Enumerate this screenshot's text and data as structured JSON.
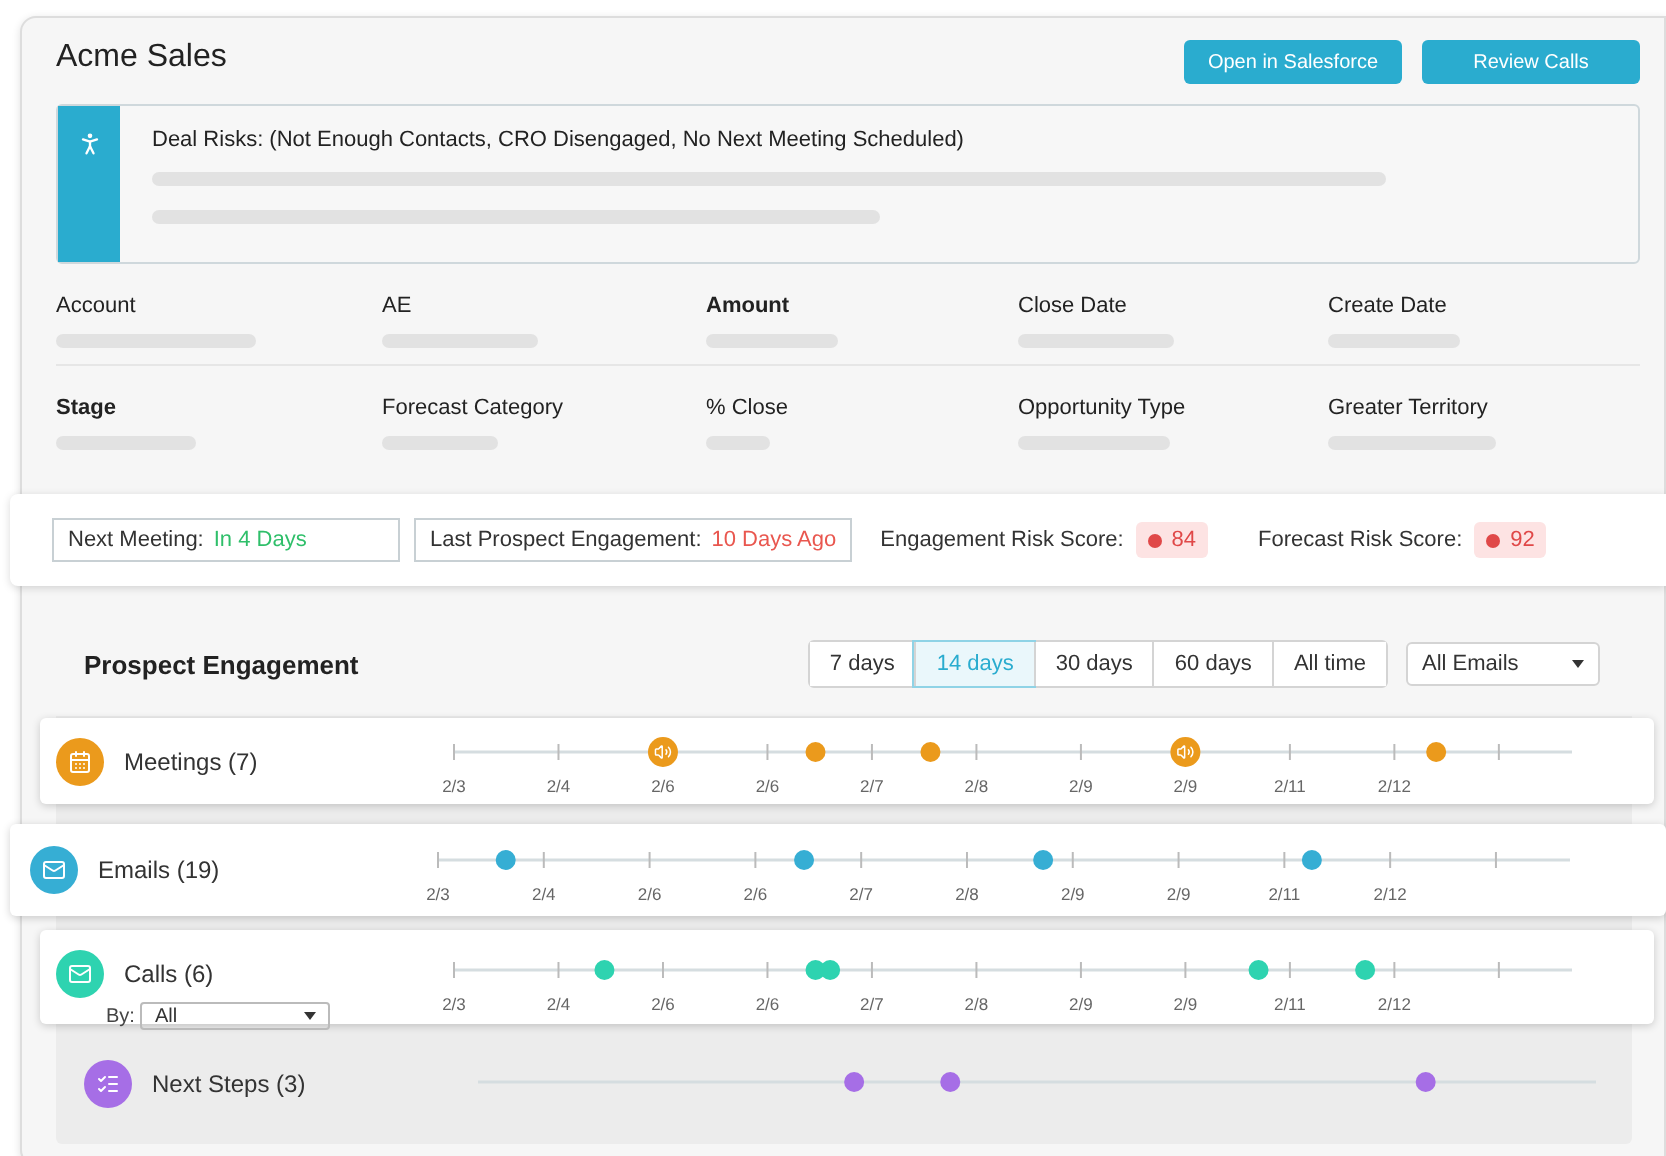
{
  "header": {
    "title": "Acme Sales",
    "buttons": [
      "Open in Salesforce",
      "Review Calls"
    ]
  },
  "alert": {
    "text": "Deal Risks: (Not Enough Contacts, CRO Disengaged, No Next Meeting Scheduled)"
  },
  "fields": [
    {
      "label": "Account",
      "emphasized": false
    },
    {
      "label": "AE",
      "emphasized": false
    },
    {
      "label": "Amount",
      "emphasized": true
    },
    {
      "label": "Close Date",
      "emphasized": false
    },
    {
      "label": "Create Date",
      "emphasized": false
    },
    {
      "label": "Stage",
      "emphasized": true
    },
    {
      "label": "Forecast Category",
      "emphasized": false
    },
    {
      "label": "% Close",
      "emphasized": false
    },
    {
      "label": "Opportunity Type",
      "emphasized": false
    },
    {
      "label": "Greater Territory",
      "emphasized": false
    }
  ],
  "metrics": [
    {
      "kind": "boxed",
      "label": "Next Meeting:",
      "value": "In 4 Days",
      "color": "#2fbf6a"
    },
    {
      "kind": "boxed",
      "label": "Last Prospect Engagement:",
      "value": "10 Days Ago",
      "color": "#e9574f"
    },
    {
      "kind": "score",
      "label": "Engagement Risk Score:",
      "value": "84",
      "color": "#e04848"
    },
    {
      "kind": "score",
      "label": "Forecast Risk Score:",
      "value": "92",
      "color": "#e04848"
    }
  ],
  "engagement": {
    "title": "Prospect Engagement",
    "ranges": [
      {
        "label": "7 days",
        "selected": false
      },
      {
        "label": "14 days",
        "selected": true
      },
      {
        "label": "30 days",
        "selected": false
      },
      {
        "label": "60 days",
        "selected": false
      },
      {
        "label": "All time",
        "selected": false
      }
    ],
    "filter": "All Emails",
    "rows": [
      {
        "kind": "meetings",
        "label": "Meetings (7)",
        "color": "#eb9a1c",
        "ticks": [
          "2/3",
          "2/4",
          "2/6",
          "2/6",
          "2/7",
          "2/8",
          "2/9",
          "2/9",
          "2/11",
          "2/12"
        ],
        "events": [
          {
            "kind": "recording"
          },
          {
            "kind": "dot"
          },
          {
            "kind": "dot"
          },
          {
            "kind": "recording"
          },
          {
            "kind": "dot"
          }
        ]
      },
      {
        "kind": "emails",
        "label": "Emails (19)",
        "color": "#36aed4",
        "ticks": [
          "2/3",
          "2/4",
          "2/6",
          "2/6",
          "2/7",
          "2/8",
          "2/9",
          "2/9",
          "2/11",
          "2/12"
        ],
        "events": [
          {
            "kind": "dot"
          },
          {
            "kind": "dot"
          },
          {
            "kind": "dot"
          },
          {
            "kind": "dot"
          }
        ]
      },
      {
        "kind": "calls",
        "label": "Calls (6)",
        "color": "#2ed3b0",
        "by_label": "By:",
        "by_value": "All",
        "ticks": [
          "2/3",
          "2/4",
          "2/6",
          "2/6",
          "2/7",
          "2/8",
          "2/9",
          "2/9",
          "2/11",
          "2/12"
        ],
        "events": [
          {
            "kind": "dot"
          },
          {
            "kind": "dot"
          },
          {
            "kind": "dot"
          },
          {
            "kind": "dot"
          },
          {
            "kind": "dot"
          }
        ]
      },
      {
        "kind": "steps",
        "label": "Next Steps (3)",
        "color": "#a66ee6",
        "events": [
          {
            "kind": "dot"
          },
          {
            "kind": "dot"
          },
          {
            "kind": "dot"
          }
        ]
      }
    ]
  }
}
